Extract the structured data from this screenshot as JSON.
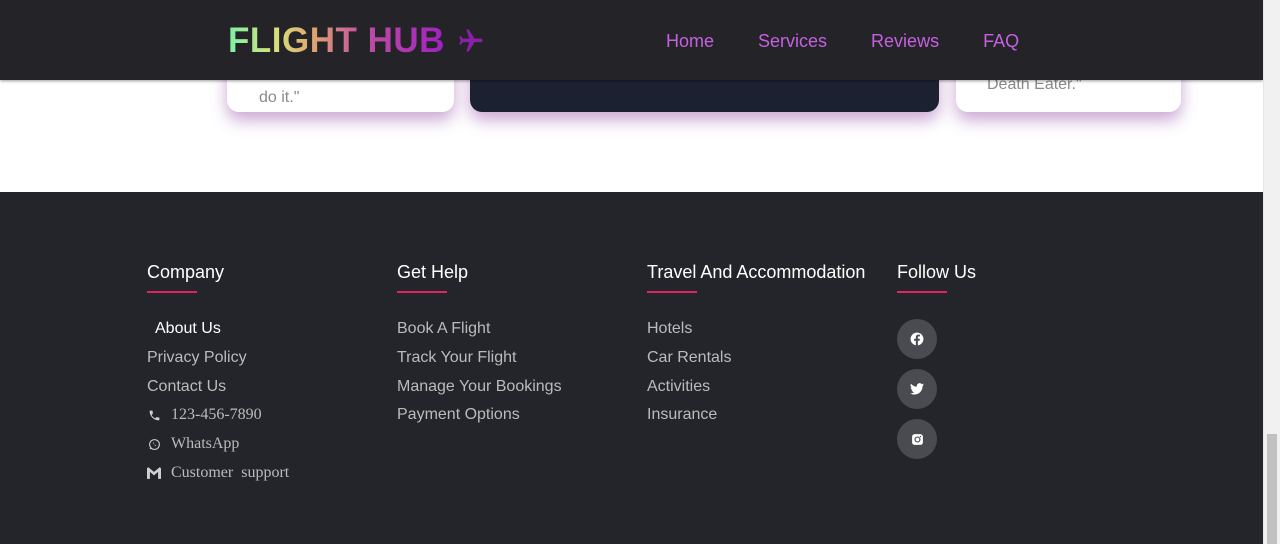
{
  "header": {
    "logo_text": "FLIGHT HUB",
    "logo_icon": "airplane-icon",
    "nav": [
      {
        "label": "Home"
      },
      {
        "label": "Services"
      },
      {
        "label": "Reviews"
      },
      {
        "label": "FAQ"
      }
    ]
  },
  "reviews": {
    "left_card_text": "do it.\"",
    "right_card_text": "Death Eater.\""
  },
  "footer": {
    "columns": [
      {
        "title": "Company",
        "links": [
          "About Us",
          "Privacy Policy",
          "Contact Us"
        ],
        "contacts": [
          {
            "icon": "phone-icon",
            "text": "123-456-7890"
          },
          {
            "icon": "whatsapp-icon",
            "text": "WhatsApp"
          },
          {
            "icon": "gmail-icon",
            "text": "Customer  support"
          }
        ]
      },
      {
        "title": "Get Help",
        "links": [
          "Book A Flight",
          "Track Your Flight",
          "Manage Your Bookings",
          "Payment Options"
        ]
      },
      {
        "title": "Travel And Accommodation",
        "links": [
          "Hotels",
          "Car Rentals",
          "Activities",
          "Insurance"
        ]
      },
      {
        "title": "Follow Us",
        "socials": [
          "facebook-icon",
          "twitter-icon",
          "instagram-icon"
        ]
      }
    ]
  },
  "colors": {
    "nav_bg": "#242428",
    "nav_link": "#c560e0",
    "footer_bg": "#24252a",
    "accent_underline": "#e0245e",
    "social_bg": "#4a4b50"
  }
}
